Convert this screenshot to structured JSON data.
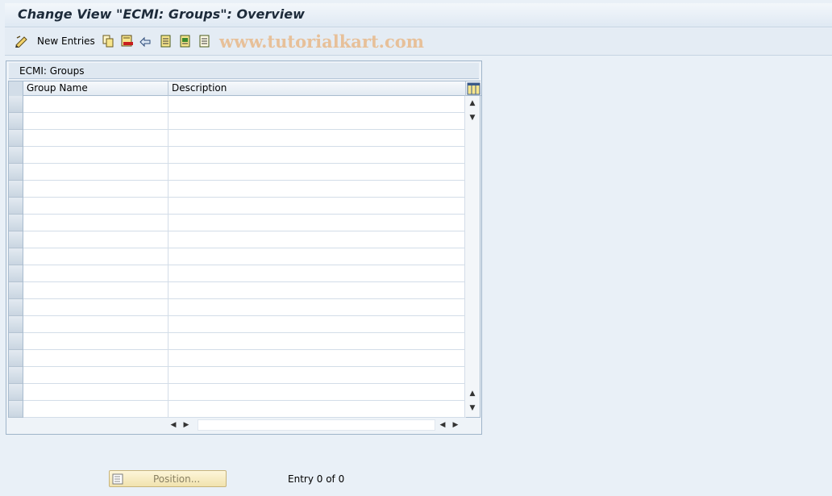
{
  "window": {
    "title": "Change View \"ECMI: Groups\": Overview"
  },
  "toolbar": {
    "new_entries_label": "New Entries",
    "watermark": "www.tutorialkart.com",
    "icons": [
      "edit-pencil-icon",
      "copy-icon",
      "delete-icon",
      "undo-change-icon",
      "select-all-icon",
      "select-block-icon",
      "deselect-all-icon"
    ]
  },
  "table": {
    "caption": "ECMI: Groups",
    "columns": [
      "Group Name",
      "Description"
    ],
    "rows": [],
    "visible_empty_rows": 19
  },
  "footer": {
    "position_button_label": "Position...",
    "entry_count": "Entry 0 of 0"
  },
  "colors": {
    "background": "#e9f0f7",
    "title_text": "#1d2b3a",
    "button_yellow": "#f1e3ae",
    "watermark": "#e8b98a"
  }
}
